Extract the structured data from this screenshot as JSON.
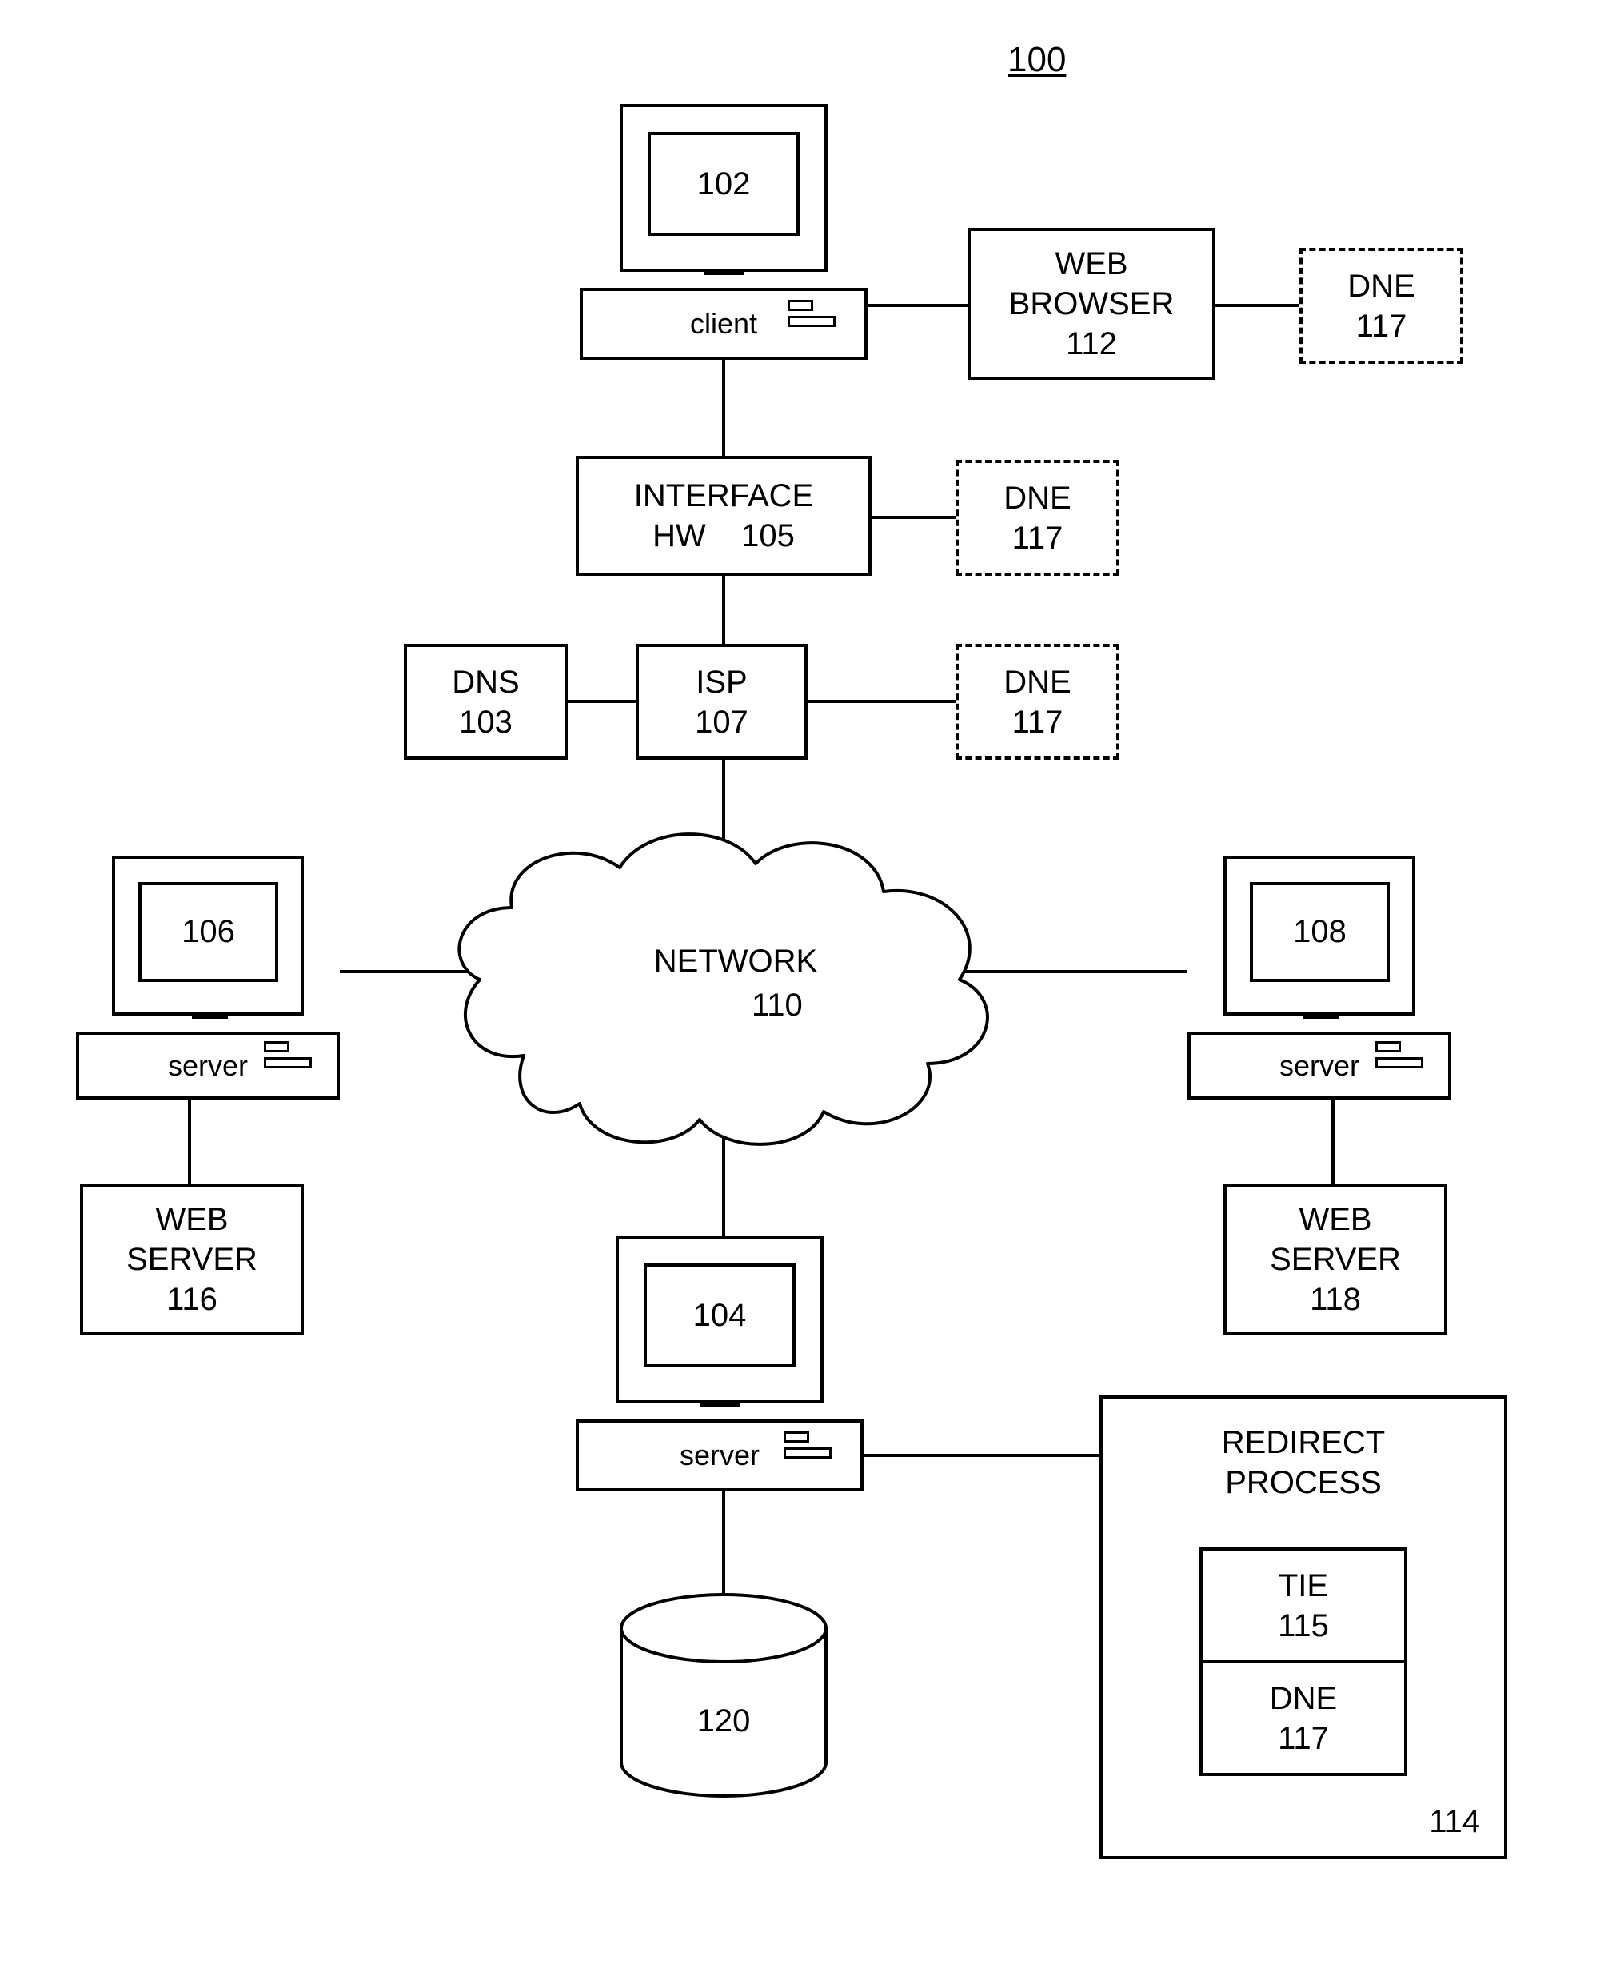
{
  "figure_ref": "100",
  "client": {
    "num": "102",
    "label": "client"
  },
  "web_browser": {
    "title": "WEB",
    "sub": "BROWSER",
    "num": "112"
  },
  "dne": {
    "label": "DNE",
    "num": "117"
  },
  "interface_hw": {
    "line1": "INTERFACE",
    "line2_a": "HW",
    "line2_b": "105"
  },
  "dns": {
    "label": "DNS",
    "num": "103"
  },
  "isp": {
    "label": "ISP",
    "num": "107"
  },
  "network": {
    "label": "NETWORK",
    "num": "110"
  },
  "server_left": {
    "num": "106",
    "label": "server",
    "ws_title": "WEB",
    "ws_sub": "SERVER",
    "ws_num": "116"
  },
  "server_right": {
    "num": "108",
    "label": "server",
    "ws_title": "WEB",
    "ws_sub": "SERVER",
    "ws_num": "118"
  },
  "server_bottom": {
    "num": "104",
    "label": "server"
  },
  "db": {
    "num": "120"
  },
  "redirect": {
    "title1": "REDIRECT",
    "title2": "PROCESS",
    "num": "114",
    "tie_label": "TIE",
    "tie_num": "115",
    "dne_label": "DNE",
    "dne_num": "117"
  }
}
